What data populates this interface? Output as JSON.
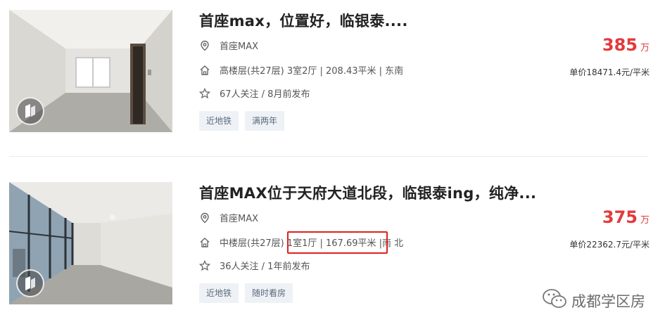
{
  "listings": [
    {
      "title": "首座max，位置好，临银泰....",
      "community": "首座MAX",
      "house_info": "高楼层(共27层) 3室2厅 | 208.43平米 | 东南",
      "follow_info": "67人关注 / 8月前发布",
      "tags": [
        "近地铁",
        "满两年"
      ],
      "total_price": "385",
      "total_unit": "万",
      "unit_price": "单价18471.4元/平米"
    },
    {
      "title": "首座MAX位于天府大道北段，临银泰ing，纯净...",
      "community": "首座MAX",
      "house_info_prefix": "中楼层(共27层) ",
      "house_info_highlight": "1室1厅 | 167.69平米 |",
      "house_info_suffix": "南 北",
      "follow_info": "36人关注 / 1年前发布",
      "tags": [
        "近地铁",
        "随时看房"
      ],
      "total_price": "375",
      "total_unit": "万",
      "unit_price": "单价22362.7元/平米"
    }
  ],
  "icons": {
    "location": "location-pin-icon",
    "house": "house-icon",
    "follow": "star-icon",
    "vr": "vr-badge-icon",
    "watermark": "wechat-icon"
  },
  "colors": {
    "price": "#e4393c",
    "highlight_box": "#e02020",
    "tag_bg": "#eef2f6"
  },
  "watermark": {
    "text": "成都学区房"
  }
}
